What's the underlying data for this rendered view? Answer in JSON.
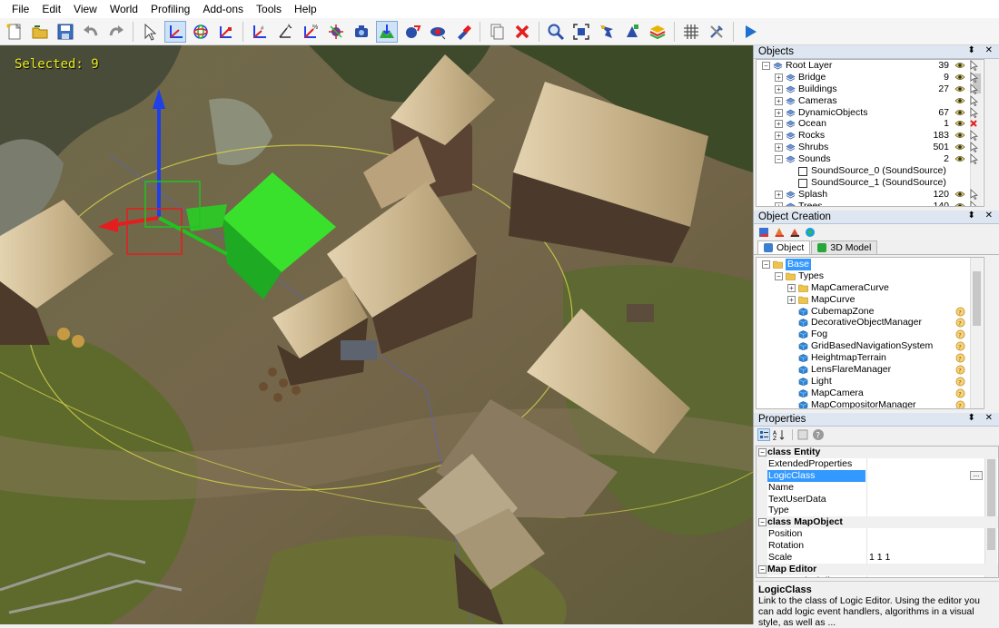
{
  "menu": [
    "File",
    "Edit",
    "View",
    "World",
    "Profiling",
    "Add-ons",
    "Tools",
    "Help"
  ],
  "toolbar": {
    "buttons": [
      {
        "name": "new-icon"
      },
      {
        "name": "open-icon"
      },
      {
        "name": "save-icon"
      },
      {
        "name": "undo-icon"
      },
      {
        "name": "redo-icon"
      },
      {
        "name": "select-icon"
      },
      {
        "name": "move-icon",
        "active": true
      },
      {
        "name": "rotate-icon"
      },
      {
        "name": "scale-icon"
      },
      {
        "name": "snap-move-icon"
      },
      {
        "name": "snap-angle-icon"
      },
      {
        "name": "snap-scale-icon"
      },
      {
        "name": "local-axes-icon"
      },
      {
        "name": "camera-focus-icon"
      },
      {
        "name": "align-terrain-icon",
        "active": true
      },
      {
        "name": "physics-icon"
      },
      {
        "name": "display-icon"
      },
      {
        "name": "paint-icon"
      },
      {
        "name": "clone-icon"
      },
      {
        "name": "delete-icon"
      },
      {
        "name": "zoom-icon"
      },
      {
        "name": "fit-selection-icon"
      },
      {
        "name": "tool-a-icon"
      },
      {
        "name": "tool-b-icon"
      },
      {
        "name": "layers-icon"
      },
      {
        "name": "grid-icon"
      },
      {
        "name": "settings-icon"
      },
      {
        "name": "play-icon"
      }
    ]
  },
  "viewport": {
    "selected_text": "Selected: 9"
  },
  "objects": {
    "title": "Objects",
    "rows": [
      {
        "label": "Root Layer",
        "count": "39",
        "indent": 0,
        "expand": "−",
        "icon": "layer",
        "vis": "eye",
        "sel": "cursor"
      },
      {
        "label": "Bridge",
        "count": "9",
        "indent": 1,
        "expand": "+",
        "icon": "layer",
        "vis": "eye",
        "sel": "cursor"
      },
      {
        "label": "Buildings",
        "count": "27",
        "indent": 1,
        "expand": "+",
        "icon": "layer",
        "vis": "eye",
        "sel": "cursor"
      },
      {
        "label": "Cameras",
        "count": "",
        "indent": 1,
        "expand": "+",
        "icon": "layer",
        "vis": "eye",
        "sel": "cursor"
      },
      {
        "label": "DynamicObjects",
        "count": "67",
        "indent": 1,
        "expand": "+",
        "icon": "layer",
        "vis": "eye",
        "sel": "cursor"
      },
      {
        "label": "Ocean",
        "count": "1",
        "indent": 1,
        "expand": "+",
        "icon": "layer",
        "vis": "eye",
        "sel": "cross"
      },
      {
        "label": "Rocks",
        "count": "183",
        "indent": 1,
        "expand": "+",
        "icon": "layer",
        "vis": "eye",
        "sel": "cursor"
      },
      {
        "label": "Shrubs",
        "count": "501",
        "indent": 1,
        "expand": "+",
        "icon": "layer",
        "vis": "eye",
        "sel": "cursor"
      },
      {
        "label": "Sounds",
        "count": "2",
        "indent": 1,
        "expand": "−",
        "icon": "layer",
        "vis": "eye",
        "sel": "cursor"
      },
      {
        "label": "SoundSource_0 (SoundSource)",
        "count": "",
        "indent": 2,
        "expand": "",
        "icon": "box",
        "vis": "",
        "sel": ""
      },
      {
        "label": "SoundSource_1 (SoundSource)",
        "count": "",
        "indent": 2,
        "expand": "",
        "icon": "box",
        "vis": "",
        "sel": ""
      },
      {
        "label": "Splash",
        "count": "120",
        "indent": 1,
        "expand": "+",
        "icon": "layer",
        "vis": "eye",
        "sel": "cursor"
      },
      {
        "label": "Trees",
        "count": "140",
        "indent": 1,
        "expand": "+",
        "icon": "layer",
        "vis": "eye",
        "sel": "cursor"
      }
    ]
  },
  "creation": {
    "title": "Object Creation",
    "tabs": [
      {
        "label": "Object",
        "active": true,
        "color": "#3a7fd0"
      },
      {
        "label": "3D Model",
        "active": false,
        "color": "#27a63a"
      }
    ],
    "rows": [
      {
        "label": "Base",
        "indent": 0,
        "expand": "−",
        "icon": "folder",
        "selected": true
      },
      {
        "label": "Types",
        "indent": 1,
        "expand": "−",
        "icon": "folder"
      },
      {
        "label": "MapCameraCurve",
        "indent": 2,
        "expand": "+",
        "icon": "folder"
      },
      {
        "label": "MapCurve",
        "indent": 2,
        "expand": "+",
        "icon": "folder"
      },
      {
        "label": "CubemapZone",
        "indent": 2,
        "expand": "",
        "icon": "cube",
        "help": true
      },
      {
        "label": "DecorativeObjectManager",
        "indent": 2,
        "expand": "",
        "icon": "cube",
        "help": true
      },
      {
        "label": "Fog",
        "indent": 2,
        "expand": "",
        "icon": "cube",
        "help": true
      },
      {
        "label": "GridBasedNavigationSystem",
        "indent": 2,
        "expand": "",
        "icon": "cube",
        "help": true
      },
      {
        "label": "HeightmapTerrain",
        "indent": 2,
        "expand": "",
        "icon": "cube",
        "help": true
      },
      {
        "label": "LensFlareManager",
        "indent": 2,
        "expand": "",
        "icon": "cube",
        "help": true
      },
      {
        "label": "Light",
        "indent": 2,
        "expand": "",
        "icon": "cube",
        "help": true
      },
      {
        "label": "MapCamera",
        "indent": 2,
        "expand": "",
        "icon": "cube",
        "help": true
      },
      {
        "label": "MapCompositorManager",
        "indent": 2,
        "expand": "",
        "icon": "cube",
        "help": true
      }
    ]
  },
  "properties": {
    "title": "Properties",
    "rows": [
      {
        "type": "cat",
        "label": "class Entity"
      },
      {
        "type": "prop",
        "name": "ExtendedProperties",
        "value": ""
      },
      {
        "type": "prop",
        "name": "LogicClass",
        "value": "",
        "selected": true,
        "ellipsis": "..."
      },
      {
        "type": "prop",
        "name": "Name",
        "value": ""
      },
      {
        "type": "prop",
        "name": "TextUserData",
        "value": ""
      },
      {
        "type": "prop",
        "name": "Type",
        "value": ""
      },
      {
        "type": "cat",
        "label": "class MapObject"
      },
      {
        "type": "prop",
        "name": "Position",
        "value": ""
      },
      {
        "type": "prop",
        "name": "Rotation",
        "value": ""
      },
      {
        "type": "prop",
        "name": "Scale",
        "value": "1 1 1"
      },
      {
        "type": "cat",
        "label": "Map Editor"
      },
      {
        "type": "prop",
        "name": "AutoVerticalAlignment",
        "value": "None"
      }
    ],
    "desc_title": "LogicClass",
    "desc_text": "Link to the class of Logic Editor. Using the editor you can add logic event handlers, algorithms in a visual style, as well as ..."
  },
  "panel_controls": "⬍ ✕"
}
